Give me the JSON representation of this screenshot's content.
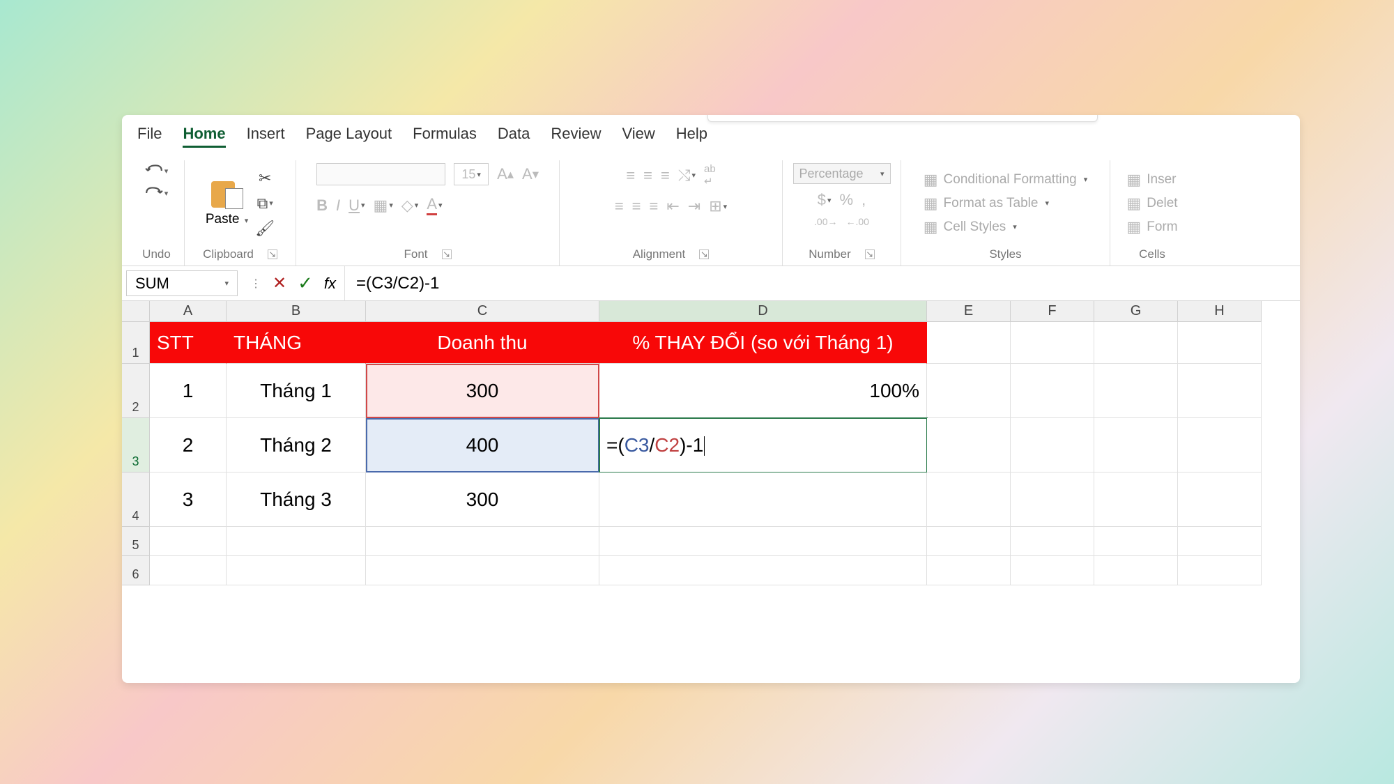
{
  "tabs": {
    "file": "File",
    "home": "Home",
    "insert": "Insert",
    "page_layout": "Page Layout",
    "formulas": "Formulas",
    "data": "Data",
    "review": "Review",
    "view": "View",
    "help": "Help"
  },
  "ribbon": {
    "undo": "Undo",
    "clipboard": "Clipboard",
    "paste": "Paste",
    "font": "Font",
    "font_size": "15",
    "alignment": "Alignment",
    "number": "Number",
    "number_format": "Percentage",
    "styles": "Styles",
    "cond_fmt": "Conditional Formatting",
    "fmt_table": "Format as Table",
    "cell_styles": "Cell Styles",
    "cells": "Cells",
    "insert_btn": "Inser",
    "delete_btn": "Delet",
    "format_btn": "Form"
  },
  "formula_bar": {
    "name_box": "SUM",
    "formula": "=(C3/C2)-1"
  },
  "columns": [
    "A",
    "B",
    "C",
    "D",
    "E",
    "F",
    "G",
    "H"
  ],
  "row_numbers": [
    "1",
    "2",
    "3",
    "4",
    "5",
    "6"
  ],
  "headers": {
    "stt": "STT",
    "thang": "THÁNG",
    "doanhthu": "Doanh thu",
    "thaydoi": "% THAY ĐỔI (so với Tháng 1)"
  },
  "rows": [
    {
      "stt": "1",
      "thang": "Tháng 1",
      "doanhthu": "300",
      "thaydoi": "100%"
    },
    {
      "stt": "2",
      "thang": "Tháng 2",
      "doanhthu": "400",
      "thaydoi_formula": {
        "c3": "C3",
        "c2": "C2"
      }
    },
    {
      "stt": "3",
      "thang": "Tháng 3",
      "doanhthu": "300",
      "thaydoi": ""
    }
  ]
}
